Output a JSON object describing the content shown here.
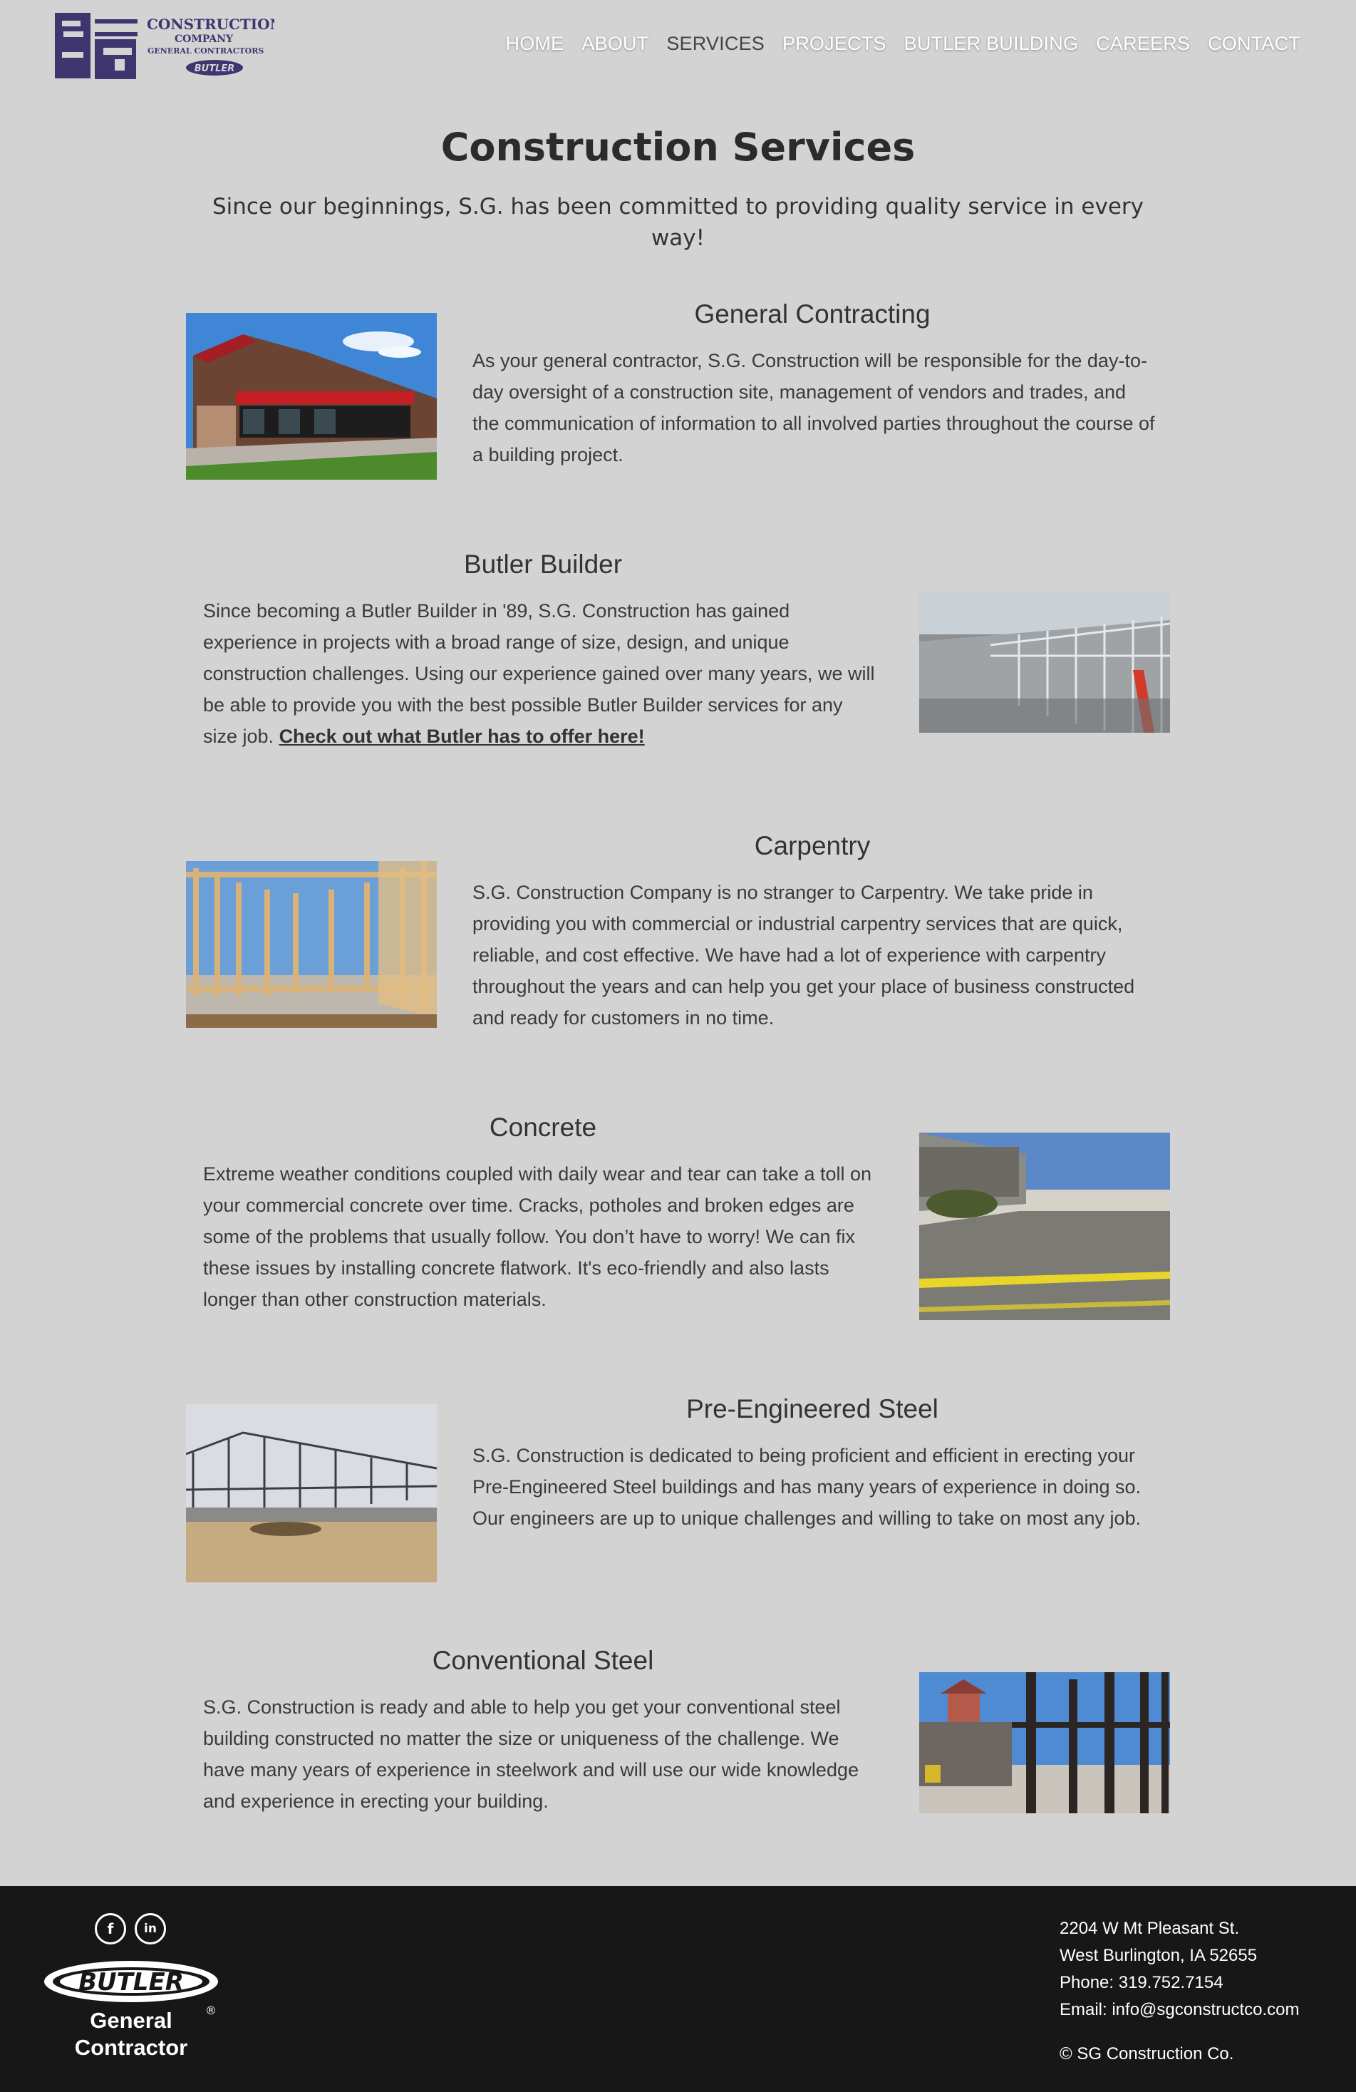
{
  "logo": {
    "letters": "SG",
    "line1": "CONSTRUCTION",
    "line2": "COMPANY",
    "line3": "GENERAL CONTRACTORS",
    "badge": "BUTLER"
  },
  "nav": {
    "items": [
      {
        "label": "HOME"
      },
      {
        "label": "ABOUT"
      },
      {
        "label": "SERVICES"
      },
      {
        "label": "PROJECTS"
      },
      {
        "label": "BUTLER BUILDING"
      },
      {
        "label": "CAREERS"
      },
      {
        "label": "CONTACT"
      }
    ],
    "active": "SERVICES"
  },
  "hero": {
    "title": "Construction Services",
    "subtitle": "Since our beginnings, S.G. has been committed to providing quality service in every way!"
  },
  "services": [
    {
      "title": "General Contracting",
      "text": "As your general contractor, S.G. Construction will be responsible for the day-to-day oversight of a construction site, management of vendors and trades, and the communication of information to all involved parties throughout the course of a building project.",
      "image": "storefront-photo"
    },
    {
      "title": "Butler Builder",
      "text": "Since becoming a Butler Builder in '89, S.G. Construction has gained experience in projects with a broad range of size, design, and unique construction challenges. Using our experience gained over many years, we will be able to provide you with the best possible Butler Builder services for any size job. ",
      "link": "Check out what Butler has to offer here!",
      "image": "steel-roof-photo"
    },
    {
      "title": "Carpentry",
      "text": "S.G. Construction Company is no stranger to Carpentry. We take pride in providing you with commercial or industrial carpentry services that are quick, reliable, and cost effective. We have had a lot of experience with carpentry throughout the years and can help you get your place of business constructed and ready for customers in no time.",
      "image": "wood-framing-photo"
    },
    {
      "title": "Concrete",
      "text": "Extreme weather conditions coupled with daily wear and tear can take a toll on your commercial concrete over time. Cracks, potholes and broken edges are some of the problems that usually follow. You don’t have to worry! We can fix these issues by installing concrete flatwork. It's eco-friendly and also lasts longer than other construction materials.",
      "image": "concrete-driveway-photo"
    },
    {
      "title": "Pre-Engineered Steel",
      "text": "S.G. Construction is dedicated to being proficient and efficient in erecting your Pre-Engineered Steel buildings and has many years of experience in doing so. Our engineers are up to unique challenges and willing to take on most any job.",
      "image": "steel-frame-photo"
    },
    {
      "title": "Conventional Steel",
      "text": "S.G. Construction is ready and able to help you get your conventional steel building constructed no matter the size or uniqueness of the challenge. We have many years of experience in steelwork and will use our wide knowledge and experience in erecting your building.",
      "image": "steel-columns-photo"
    }
  ],
  "footer": {
    "social": [
      {
        "icon": "facebook-icon",
        "glyph": "f"
      },
      {
        "icon": "linkedin-icon",
        "glyph": "in"
      }
    ],
    "badge": {
      "name": "BUTLER",
      "line1": "General",
      "line2": "Contractor",
      "mark": "®"
    },
    "address1": "2204 W Mt Pleasant St.",
    "address2": "West Burlington, IA 52655",
    "phone": "Phone: 319.752.7154",
    "email": "Email: info@sgconstructco.com",
    "copyright": "© SG Construction Co."
  },
  "colors": {
    "background": "#d3d3d3",
    "brand_purple": "#3f3670",
    "footer_bg": "#171717"
  }
}
